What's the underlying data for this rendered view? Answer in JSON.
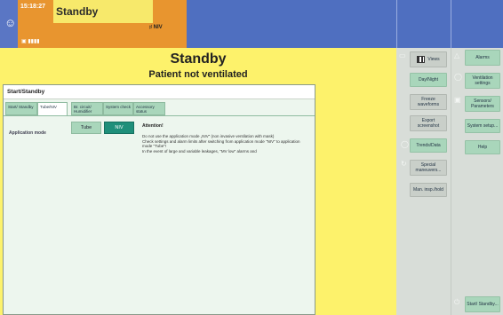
{
  "topbar": {
    "time": "15:18:27",
    "status": "Standby",
    "mode_badge": "NIV",
    "battery": "▣ ▮▮▮▮"
  },
  "main": {
    "title": "Standby",
    "subtitle": "Patient not ventilated"
  },
  "dialog": {
    "title": "Start/Standby",
    "tabs": [
      {
        "label": "Start/ Standby"
      },
      {
        "label": "Tube/NIV"
      },
      {
        "label": "Br. circuit/ Humidifier"
      },
      {
        "label": "System check"
      },
      {
        "label": "Accessory status"
      }
    ],
    "application_mode_label": "Application mode",
    "tube_label": "Tube",
    "niv_label": "NIV",
    "attention_title": "Attention!",
    "attention_text": "Do not use the application mode „NIV“ (non invasive ventilation with mask)\nCheck settings and alarm limits after switching from application mode \"NIV\" to application mode \"Tube\"!\nIn the event of large and variable leakages, \"MV low\" alarms and"
  },
  "right_panel": {
    "views": "Views",
    "day_night": "Day/Night",
    "freeze": "Freeze waveforms",
    "export": "Export screenshot",
    "trends": "Trends/Data",
    "special": "Special maneuvers...",
    "man_insp": "Man. insp./hold",
    "alarms": "Alarms",
    "vent_settings": "Ventilation settings",
    "sensors": "Sensors/ Parameters",
    "system_setup": "System setup...",
    "help": "Help",
    "start_standby": "Start/ Standby..."
  },
  "colors": {
    "header_blue": "#4f6fc0",
    "status_yellow": "#f7e96b",
    "status_orange": "#e8952f",
    "main_yellow": "#fdf26b",
    "button_green": "#a9d6bb",
    "selected_teal": "#1f8f7a"
  }
}
